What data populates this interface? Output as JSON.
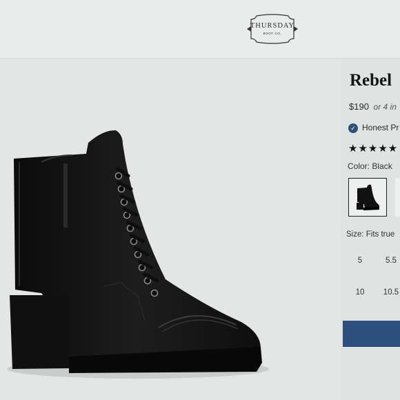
{
  "brand": {
    "name": "THURSDAY",
    "tagline": "BOOT CO."
  },
  "product": {
    "title": "Rebel",
    "price": "$190",
    "installments": "or 4 in",
    "badge": "Honest Pr",
    "rating_stars": "★★★★★",
    "rating_value": 5,
    "color_label": "Color: Black",
    "size_label": "Size: Fits true",
    "sizes": [
      "5",
      "5.5",
      "10",
      "10.5"
    ],
    "add_to_cart_color": "#2d4f7f"
  }
}
